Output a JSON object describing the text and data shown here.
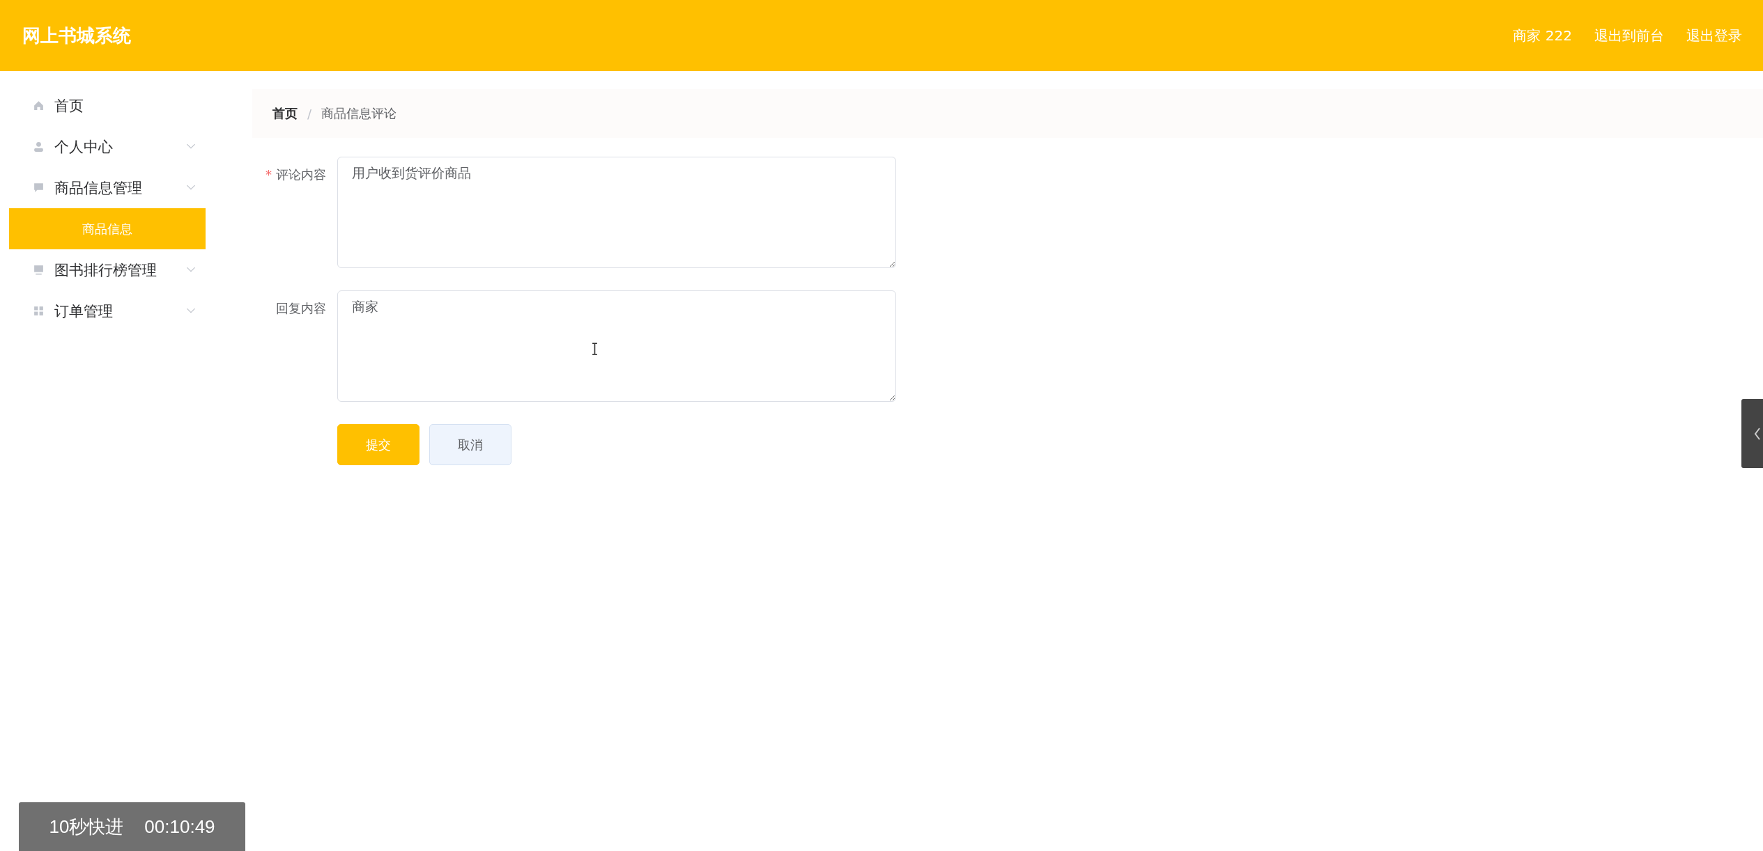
{
  "header": {
    "title": "网上书城系统",
    "user": "商家 222",
    "links": [
      "退出到前台",
      "退出登录"
    ]
  },
  "sidebar": {
    "items": [
      {
        "label": "首页",
        "submenu": false,
        "selected": false
      },
      {
        "label": "个人中心",
        "submenu": true,
        "selected": false
      },
      {
        "label": "商品信息管理",
        "submenu": true,
        "selected": false,
        "children": [
          {
            "label": "商品信息",
            "selected": true
          }
        ]
      },
      {
        "label": "图书排行榜管理",
        "submenu": true,
        "selected": false
      },
      {
        "label": "订单管理",
        "submenu": true,
        "selected": false
      }
    ]
  },
  "breadcrumb": [
    "首页",
    "商品信息评论"
  ],
  "breadcrumb_separator": "/",
  "form": {
    "required_mark": "*",
    "fields": [
      {
        "label": "评论内容",
        "required": true,
        "value": "用户收到货评价商品"
      },
      {
        "label": "回复内容",
        "required": false,
        "value": "商家"
      }
    ],
    "buttons": [
      {
        "label": "提交",
        "kind": "primary"
      },
      {
        "label": "取消",
        "kind": "default"
      }
    ]
  },
  "player": {
    "skip": "10秒快进",
    "time": "00:10:49"
  }
}
